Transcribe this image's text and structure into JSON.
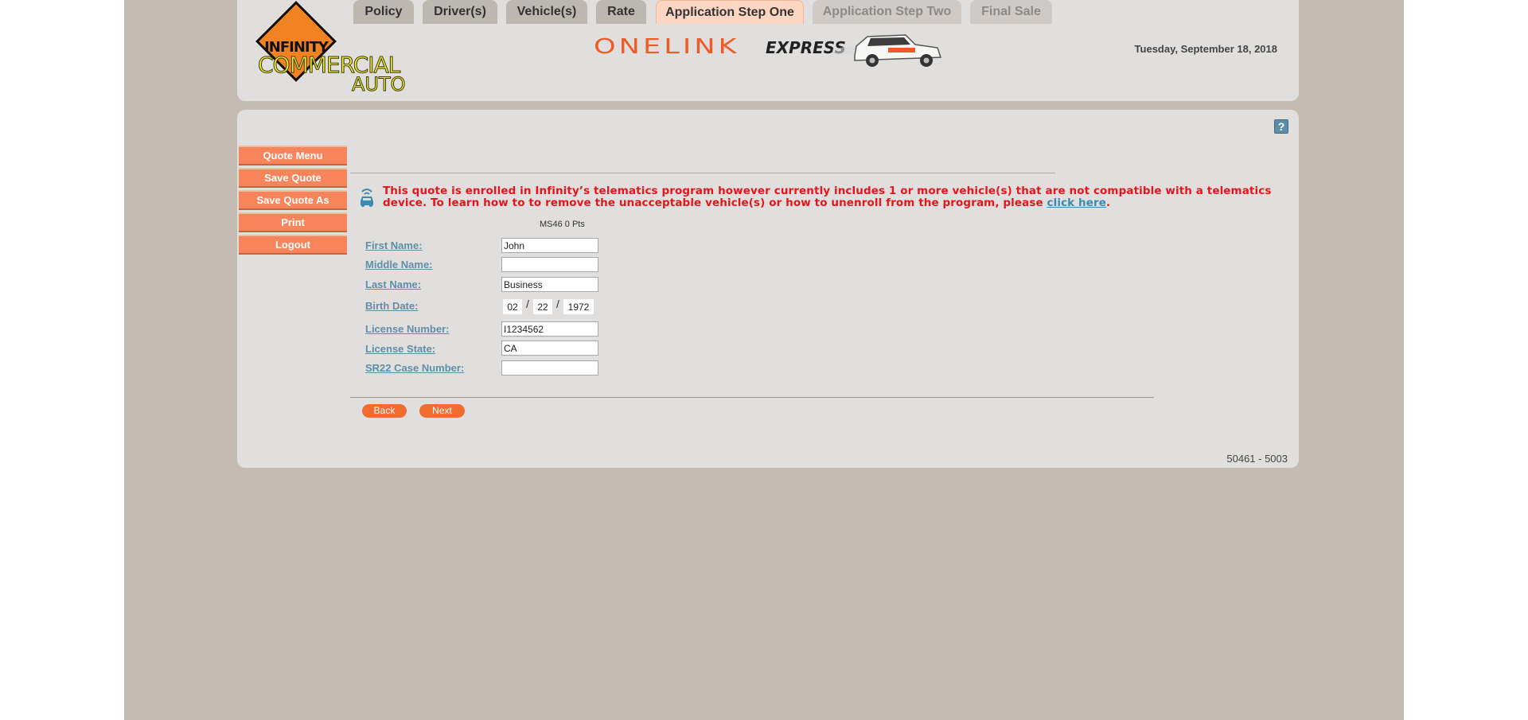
{
  "header": {
    "logo": {
      "infinity": "INFINITY",
      "commercial": "COMMERCIAL",
      "auto": "AUTO"
    },
    "banner": {
      "onelink": "ONELINK",
      "express": "EXPRESS"
    },
    "date": "Tuesday, September 18, 2018"
  },
  "help": {
    "label": "?"
  },
  "side_menu": {
    "items": [
      {
        "label": "Quote Menu"
      },
      {
        "label": "Save Quote"
      },
      {
        "label": "Save Quote As"
      },
      {
        "label": "Print"
      },
      {
        "label": "Logout"
      }
    ]
  },
  "tabs": [
    {
      "label": "Policy",
      "state": "normal"
    },
    {
      "label": "Driver(s)",
      "state": "normal"
    },
    {
      "label": "Vehicle(s)",
      "state": "normal"
    },
    {
      "label": "Rate",
      "state": "normal"
    },
    {
      "label": "Application Step One",
      "state": "active"
    },
    {
      "label": "Application Step Two",
      "state": "disabled"
    },
    {
      "label": "Final Sale",
      "state": "disabled"
    }
  ],
  "notice": {
    "text": "This quote is enrolled in Infinity’s telematics program however currently includes 1 or more vehicle(s) that are not compatible with a telematics device. To learn how to to remove the unacceptable vehicle(s) or how to unenroll from the program, please ",
    "link": "click here",
    "suffix": "."
  },
  "points": "MS46 0 Pts",
  "form": {
    "first_name": {
      "label": "First Name:",
      "value": "John"
    },
    "middle_name": {
      "label": "Middle Name:",
      "value": ""
    },
    "last_name": {
      "label": "Last Name:",
      "value": "Business"
    },
    "birth_date": {
      "label": "Birth Date:",
      "month": "02",
      "day": "22",
      "year": "1972",
      "separator": "/"
    },
    "license_number": {
      "label": "License Number:",
      "value": "I1234562"
    },
    "license_state": {
      "label": "License State:",
      "value": "CA"
    },
    "sr22": {
      "label": "SR22 Case Number:",
      "value": ""
    }
  },
  "actions": {
    "back": "Back",
    "next": "Next"
  },
  "footer": {
    "code": "50461 - 5003"
  },
  "colors": {
    "accent": "#f26b2f",
    "menu": "#f7845a",
    "warning": "#e8141b",
    "link": "#3a8bb2",
    "label": "#5e8ea8"
  }
}
